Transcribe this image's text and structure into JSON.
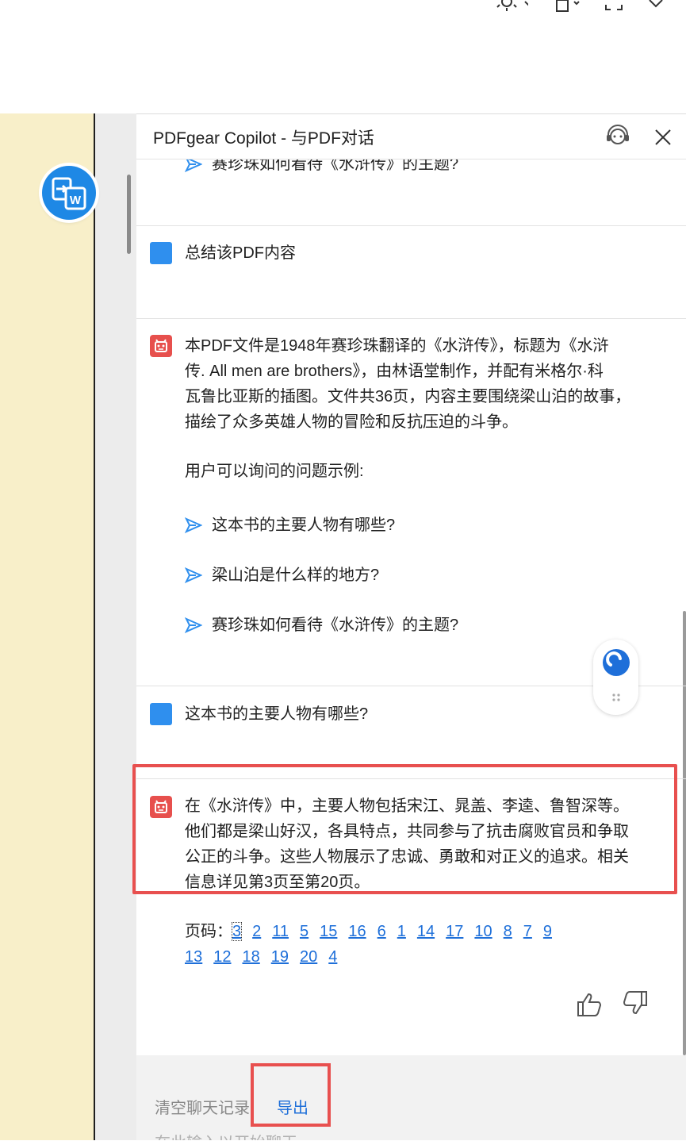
{
  "window": {
    "top_icons": [
      "brightness-icon",
      "export-icon",
      "fullscreen-icon",
      "close-icon"
    ]
  },
  "panel": {
    "title": "PDFgear Copilot - 与PDF对话"
  },
  "chat": {
    "partial_suggestion": "赛珍珠如何看待《水浒传》的主题?",
    "user_message_1": "总结该PDF内容",
    "bot_message_1": {
      "lines": [
        "本PDF文件是1948年赛珍珠翻译的《水浒传》，标题为《水浒",
        "传. All men are brothers》，由林语堂制作，并配有米格尔·科",
        "瓦鲁比亚斯的插图。文件共36页，内容主要围绕梁山泊的故事，",
        "描绘了众多英雄人物的冒险和反抗压迫的斗争。"
      ],
      "examples_label": "用户可以询问的问题示例:",
      "suggestions": [
        "这本书的主要人物有哪些?",
        "梁山泊是什么样的地方?",
        "赛珍珠如何看待《水浒传》的主题?"
      ]
    },
    "user_message_2": "这本书的主要人物有哪些?",
    "bot_message_2": {
      "lines": [
        "在《水浒传》中，主要人物包括宋江、晁盖、李逵、鲁智深等。",
        "他们都是梁山好汉，各具特点，共同参与了抗击腐败官员和争取",
        "公正的斗争。这些人物展示了忠诚、勇敢和对正义的追求。相关",
        "信息详见第3页至第20页。"
      ],
      "pages_label": "页码：",
      "pages": [
        "3",
        "2",
        "11",
        "5",
        "15",
        "16",
        "6",
        "1",
        "14",
        "17",
        "10",
        "8",
        "7",
        "9",
        "13",
        "12",
        "18",
        "19",
        "20",
        "4"
      ]
    }
  },
  "footer": {
    "clear_label": "清空聊天记录",
    "export_label": "导出",
    "input_placeholder": "在此输入以开始聊天"
  },
  "colors": {
    "accent": "#1e88e5",
    "user_avatar": "#2f8fee",
    "bot_avatar": "#e7504d",
    "highlight": "#e8504f",
    "doc_background": "#f8efc9"
  }
}
